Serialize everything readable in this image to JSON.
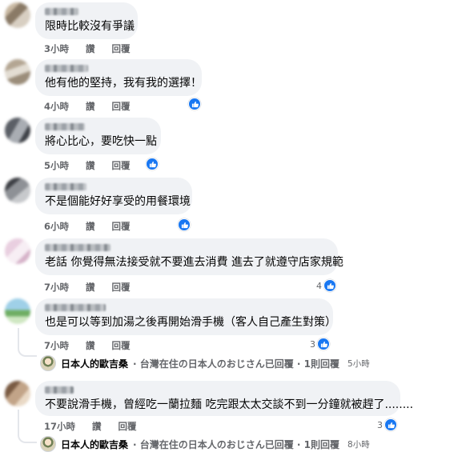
{
  "comments": [
    {
      "text": "限時比較沒有爭議",
      "time": "3小時",
      "like": "讚",
      "reply": "回覆",
      "reaction_count": "",
      "has_reaction": false
    },
    {
      "text": "他有他的堅持，我有我的選擇！",
      "time": "4小時",
      "like": "讚",
      "reply": "回覆",
      "reaction_count": "",
      "has_reaction": true
    },
    {
      "text": "將心比心，要吃快一點",
      "time": "5小時",
      "like": "讚",
      "reply": "回覆",
      "reaction_count": "",
      "has_reaction": true
    },
    {
      "text": "不是個能好好享受的用餐環境",
      "time": "6小時",
      "like": "讚",
      "reply": "回覆",
      "reaction_count": "",
      "has_reaction": true
    },
    {
      "text": "老話 你覺得無法接受就不要進去消費 進去了就遵守店家規範",
      "time": "7小時",
      "like": "讚",
      "reply": "回覆",
      "reaction_count": "4",
      "has_reaction": true
    },
    {
      "text": "也是可以等到加湯之後再開始滑手機（客人自己產生對策）",
      "time": "7小時",
      "like": "讚",
      "reply": "回覆",
      "reaction_count": "3",
      "has_reaction": true
    },
    {
      "text": "不要說滑手機，曾經吃一蘭拉麵 吃完跟太太交談不到一分鐘就被趕了........",
      "time": "17小時",
      "like": "讚",
      "reply": "回覆",
      "reaction_count": "3",
      "has_reaction": true
    }
  ],
  "replies": [
    {
      "author": "日本人的歐吉桑",
      "summary": "· 台灣在住の日本人のおじさん已回覆 · 1則回覆",
      "time": "5小時"
    },
    {
      "author": "日本人的歐吉桑",
      "summary": "· 台灣在住の日本人のおじさん已回覆 · 1則回覆",
      "time": "8小時"
    }
  ],
  "colors": {
    "like_blue": "#1877f2",
    "bubble_gray": "#f0f2f5",
    "meta_gray": "#65676b"
  }
}
